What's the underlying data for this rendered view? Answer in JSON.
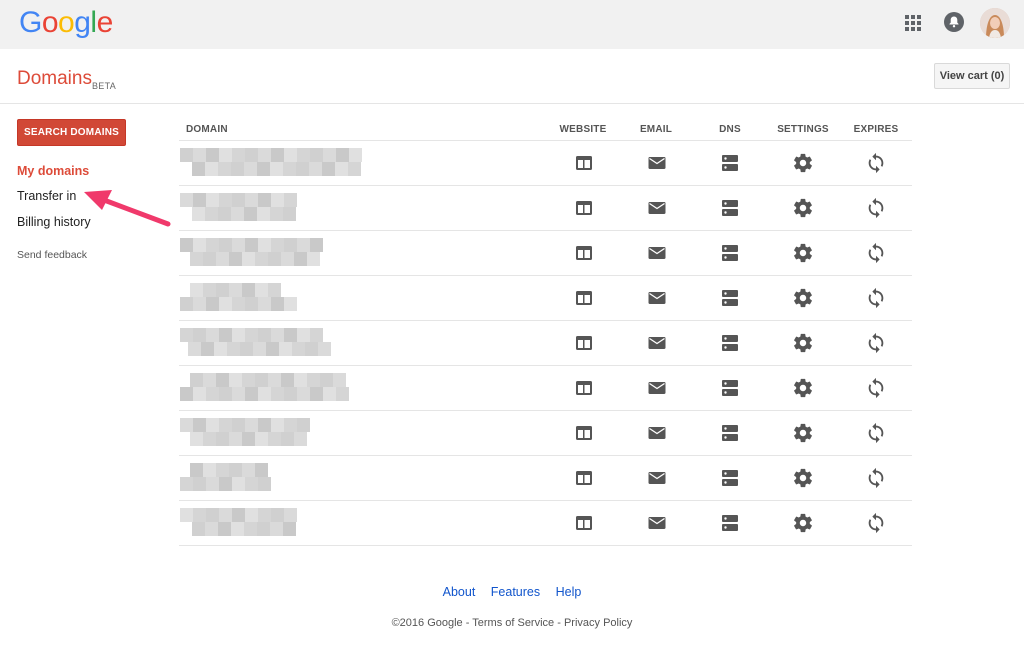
{
  "header": {
    "logo_letters": [
      {
        "char": "G",
        "color": "#4285f4"
      },
      {
        "char": "o",
        "color": "#ea4335"
      },
      {
        "char": "o",
        "color": "#fbbc05"
      },
      {
        "char": "g",
        "color": "#4285f4"
      },
      {
        "char": "l",
        "color": "#34a853"
      },
      {
        "char": "e",
        "color": "#ea4335"
      }
    ],
    "icons": [
      "apps-grid-icon",
      "notifications-bell-icon",
      "user-avatar"
    ]
  },
  "subheader": {
    "title": "Domains",
    "badge": "BETA",
    "view_cart_label": "View cart (0)"
  },
  "sidebar": {
    "search_button_label": "SEARCH DOMAINS",
    "items": [
      {
        "label": "My domains",
        "active": true
      },
      {
        "label": "Transfer in",
        "active": false
      },
      {
        "label": "Billing history",
        "active": false
      }
    ],
    "feedback_label": "Send feedback"
  },
  "table": {
    "columns": [
      "DOMAIN",
      "WEBSITE",
      "EMAIL",
      "DNS",
      "SETTINGS",
      "EXPIRES"
    ],
    "row_icons": [
      "website-icon",
      "email-icon",
      "dns-icon",
      "settings-icon",
      "expires-renew-icon"
    ],
    "row_count": 9,
    "domain_names_obscured": true
  },
  "footer": {
    "links": [
      "About",
      "Features",
      "Help"
    ],
    "copyright": "©2016 Google",
    "terms": "Terms of Service",
    "privacy": "Privacy Policy",
    "separator": " - "
  },
  "colors": {
    "accent_red": "#dd4b39",
    "button_red": "#d14836",
    "link_blue": "#1155cc",
    "annotation_pink": "#f0396b",
    "icon_gray": "#555555"
  }
}
